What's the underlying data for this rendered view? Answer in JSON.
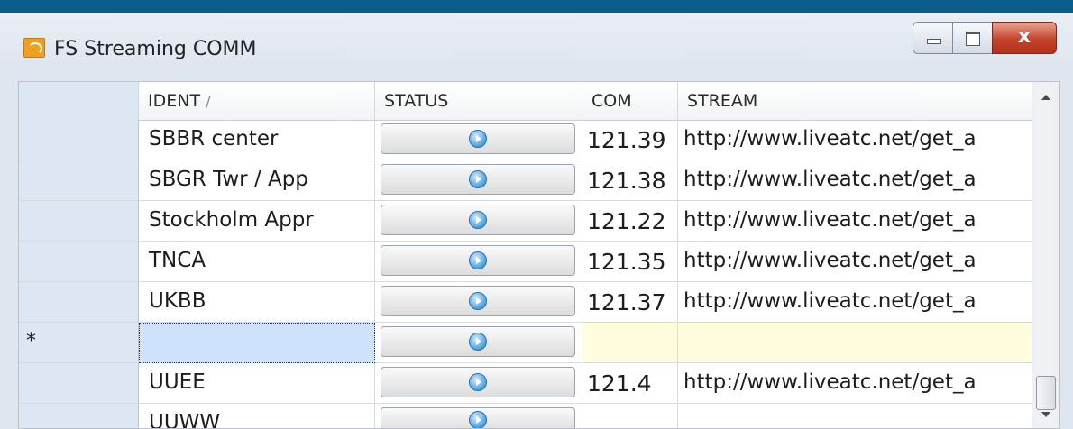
{
  "window": {
    "title": "FS Streaming COMM",
    "icon": "radio-app-icon",
    "controls": [
      "minimize-icon",
      "maximize-icon",
      "close-icon"
    ],
    "close_glyph": "x"
  },
  "grid": {
    "columns": [
      "IDENT",
      "STATUS",
      "COM",
      "STREAM"
    ],
    "sort_indicator": "/",
    "rows": [
      {
        "marker": "",
        "ident": "SBBR center",
        "com": "121.39",
        "stream": "http://www.liveatc.net/get_a"
      },
      {
        "marker": "",
        "ident": "SBGR Twr / App",
        "com": "121.38",
        "stream": "http://www.liveatc.net/get_a"
      },
      {
        "marker": "",
        "ident": "Stockholm Appr",
        "com": "121.22",
        "stream": "http://www.liveatc.net/get_a"
      },
      {
        "marker": "",
        "ident": "TNCA",
        "com": "121.35",
        "stream": "http://www.liveatc.net/get_a"
      },
      {
        "marker": "",
        "ident": "UKBB",
        "com": "121.37",
        "stream": "http://www.liveatc.net/get_a"
      },
      {
        "marker": "*",
        "ident": "",
        "com": "",
        "stream": ""
      },
      {
        "marker": "",
        "ident": "UUEE",
        "com": "121.4",
        "stream": "http://www.liveatc.net/get_a"
      },
      {
        "marker": "",
        "ident": "UUWW",
        "com": "",
        "stream": ""
      }
    ]
  },
  "colors": {
    "titlebar_blue": "#0b5e8c",
    "row_header": "#dde6f3",
    "new_row_fill": "#fffbdc",
    "selected_cell": "#cfe2fb"
  }
}
